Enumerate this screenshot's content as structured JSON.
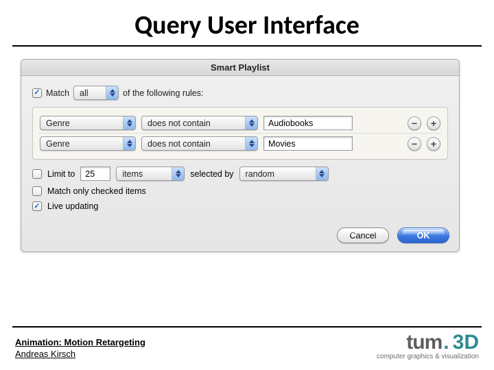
{
  "slide": {
    "title": "Query User Interface"
  },
  "panel": {
    "title": "Smart Playlist",
    "match": {
      "checked": true,
      "prefix": "Match",
      "mode": "all",
      "suffix": "of the following rules:"
    },
    "rules": [
      {
        "field": "Genre",
        "op": "does not contain",
        "value": "Audiobooks"
      },
      {
        "field": "Genre",
        "op": "does not contain",
        "value": "Movies"
      }
    ],
    "limit": {
      "checked": false,
      "label": "Limit to",
      "count": "25",
      "unit": "items",
      "selected_by_label": "selected by",
      "method": "random"
    },
    "match_only": {
      "checked": false,
      "label": "Match only checked items"
    },
    "live": {
      "checked": true,
      "label": "Live updating"
    },
    "buttons": {
      "cancel": "Cancel",
      "ok": "OK"
    }
  },
  "footer": {
    "line1": "Animation: Motion Retargeting",
    "line2": "Andreas Kirsch",
    "brand_tum": "tum",
    "brand_3d": "3D",
    "brand_sub": "computer graphics & visualization"
  }
}
